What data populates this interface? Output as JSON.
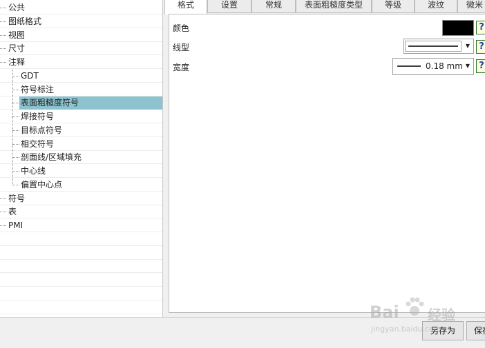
{
  "tree": {
    "items": [
      {
        "label": "公共",
        "level": 0
      },
      {
        "label": "图纸格式",
        "level": 0
      },
      {
        "label": "视图",
        "level": 0
      },
      {
        "label": "尺寸",
        "level": 0
      },
      {
        "label": "注释",
        "level": 0
      },
      {
        "label": "GDT",
        "level": 1
      },
      {
        "label": "符号标注",
        "level": 1
      },
      {
        "label": "表面粗糙度符号",
        "level": 1,
        "selected": true
      },
      {
        "label": "焊接符号",
        "level": 1
      },
      {
        "label": "目标点符号",
        "level": 1
      },
      {
        "label": "相交符号",
        "level": 1
      },
      {
        "label": "剖面线/区域填充",
        "level": 1
      },
      {
        "label": "中心线",
        "level": 1
      },
      {
        "label": "偏置中心点",
        "level": 1
      },
      {
        "label": "符号",
        "level": 0
      },
      {
        "label": "表",
        "level": 0
      },
      {
        "label": "PMI",
        "level": 0
      }
    ]
  },
  "tabs": [
    "格式",
    "设置",
    "常规",
    "表面粗糙度类型",
    "等级",
    "波纹",
    "微米"
  ],
  "form": {
    "color_label": "颜色",
    "color_value": "#000000",
    "linetype_label": "线型",
    "width_label": "宽度",
    "width_value": "0.18 mm",
    "help_glyph": "?"
  },
  "buttons": {
    "save_as": "另存为",
    "save": "保存"
  },
  "watermark": {
    "brand": "Bai",
    "brand_tail": "经验",
    "url": "jingyan.baidu.com"
  }
}
